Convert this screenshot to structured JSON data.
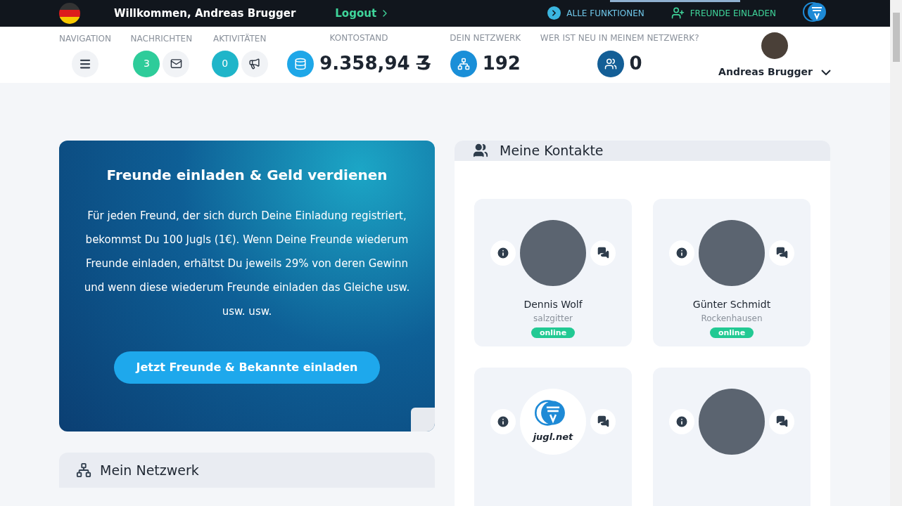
{
  "topbar": {
    "welcome": "Willkommen, Andreas Brugger",
    "logout": "Logout",
    "links": [
      {
        "kind": "functions",
        "label": "ALLE FUNKTIONEN"
      },
      {
        "kind": "invite",
        "label": "FREUNDE EINLADEN"
      }
    ]
  },
  "stats": [
    {
      "kind": "menu",
      "label": "NAVIGATION"
    },
    {
      "kind": "counter",
      "label": "NACHRICHTEN",
      "count": "3",
      "color": "#2ecc9a"
    },
    {
      "kind": "counter",
      "label": "AKTIVITÄTEN",
      "count": "0",
      "color": "#1fb5c9"
    },
    {
      "kind": "value",
      "label": "KONTOSTAND",
      "value": "9.358,94",
      "unit": "Ʒ",
      "color": "#1ea7e8"
    },
    {
      "kind": "value",
      "label": "DEIN NETZWERK",
      "value": "192",
      "color": "#1a8fd8"
    },
    {
      "kind": "value",
      "label": "WER IST NEU IN MEINEM NETZWERK?",
      "value": "0",
      "color": "#135e96"
    }
  ],
  "user": {
    "name": "Andreas Brugger"
  },
  "promo": {
    "title": "Freunde einladen & Geld verdienen",
    "text": "Für jeden Freund, der sich durch Deine Einladung registriert, bekommst Du 100 Jugls (1€). Wenn Deine Freunde wiederum Freunde einladen, erhältst Du jeweils 29% von deren Gewinn und wenn diese wiederum Freunde einladen das Gleiche usw. usw. usw.",
    "button": "Jetzt Freunde & Bekannte einladen"
  },
  "network_panel": {
    "title": "Mein Netzwerk"
  },
  "contacts": {
    "title": "Meine Kontakte",
    "items": [
      {
        "kind": "photo",
        "name": "Dennis Wolf",
        "city": "salzgitter",
        "online": true,
        "status": "online"
      },
      {
        "kind": "photo",
        "name": "Günter Schmidt",
        "city": "Rockenhausen",
        "online": true,
        "status": "online"
      },
      {
        "kind": "logo",
        "logo_text": "jugl.net"
      },
      {
        "kind": "photo"
      }
    ]
  }
}
